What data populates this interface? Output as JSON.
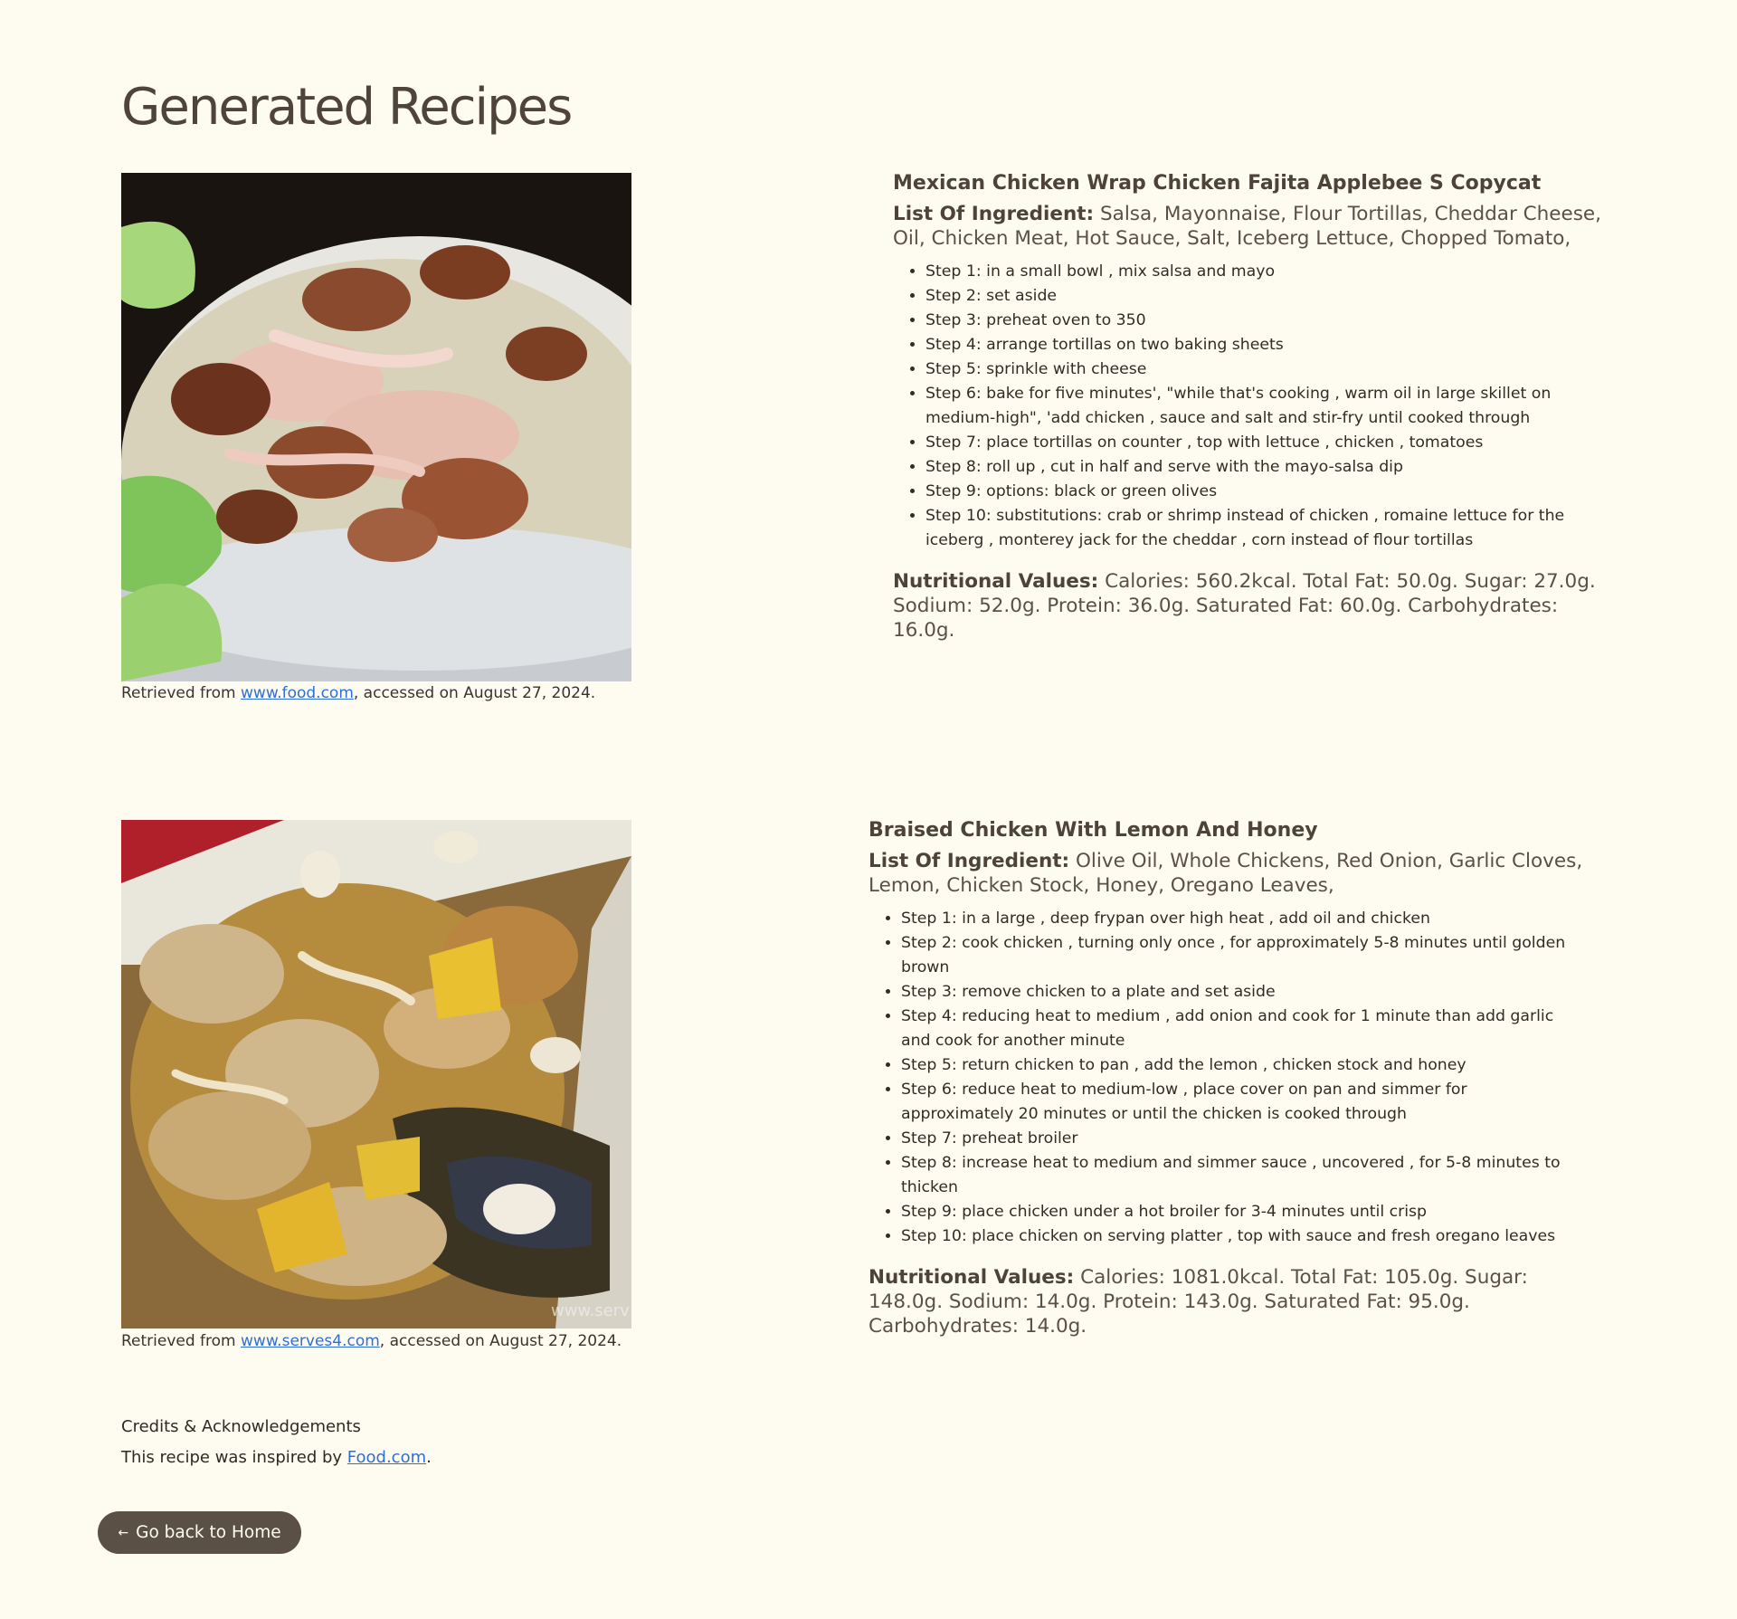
{
  "page": {
    "title": "Generated Recipes"
  },
  "recipes": [
    {
      "name": "Mexican Chicken Wrap Chicken Fajita Applebee S Copycat",
      "ingredients_label": "List Of Ingredient:",
      "ingredients": "Salsa, Mayonnaise, Flour Tortillas, Cheddar Cheese, Oil, Chicken Meat, Hot Sauce, Salt, Iceberg Lettuce, Chopped Tomato,",
      "steps": [
        "Step 1: in a small bowl , mix salsa and mayo",
        "Step 2: set aside",
        "Step 3: preheat oven to 350",
        "Step 4: arrange tortillas on two baking sheets",
        "Step 5: sprinkle with cheese",
        "Step 6: bake for five minutes', \"while that's cooking , warm oil in large skillet on medium-high\", 'add chicken , sauce and salt and stir-fry until cooked through",
        "Step 7: place tortillas on counter , top with lettuce , chicken , tomatoes",
        "Step 8: roll up , cut in half and serve with the mayo-salsa dip",
        "Step 9: options: black or green olives",
        "Step 10: substitutions: crab or shrimp instead of chicken , romaine lettuce for the iceberg , monterey jack for the cheddar , corn instead of flour tortillas"
      ],
      "nutrition_label": "Nutritional Values:",
      "nutrition": "Calories: 560.2kcal. Total Fat: 50.0g. Sugar: 27.0g. Sodium: 52.0g. Protein: 36.0g. Saturated Fat: 60.0g. Carbohydrates: 16.0g.",
      "source_prefix": "Retrieved from ",
      "source_link": "www.food.com",
      "source_suffix": ", accessed on August 27, 2024."
    },
    {
      "name": "Braised Chicken With Lemon And Honey",
      "ingredients_label": "List Of Ingredient:",
      "ingredients": "Olive Oil, Whole Chickens, Red Onion, Garlic Cloves, Lemon, Chicken Stock, Honey, Oregano Leaves,",
      "steps": [
        "Step 1: in a large , deep frypan over high heat , add oil and chicken",
        "Step 2: cook chicken , turning only once , for approximately 5-8 minutes until golden brown",
        "Step 3: remove chicken to a plate and set aside",
        "Step 4: reducing heat to medium , add onion and cook for 1 minute than add garlic and cook for another minute",
        "Step 5: return chicken to pan , add the lemon , chicken stock and honey",
        "Step 6: reduce heat to medium-low , place cover on pan and simmer for approximately 20 minutes or until the chicken is cooked through",
        "Step 7: preheat broiler",
        "Step 8: increase heat to medium and simmer sauce , uncovered , for 5-8 minutes to thicken",
        "Step 9: place chicken under a hot broiler for 3-4 minutes until crisp",
        "Step 10: place chicken on serving platter , top with sauce and fresh oregano leaves"
      ],
      "nutrition_label": "Nutritional Values:",
      "nutrition": "Calories: 1081.0kcal. Total Fat: 105.0g. Sugar: 148.0g. Sodium: 14.0g. Protein: 143.0g. Saturated Fat: 95.0g. Carbohydrates: 14.0g.",
      "source_prefix": "Retrieved from ",
      "source_link": "www.serves4.com",
      "source_suffix": ", accessed on August 27, 2024.",
      "watermark": "www.serv"
    }
  ],
  "credits": {
    "title": "Credits & Acknowledgements",
    "text_prefix": "This recipe was inspired by ",
    "link": "Food.com",
    "text_suffix": "."
  },
  "home_button": {
    "icon": "arrow-left-icon",
    "arrow": "←",
    "label": "Go back to Home"
  }
}
